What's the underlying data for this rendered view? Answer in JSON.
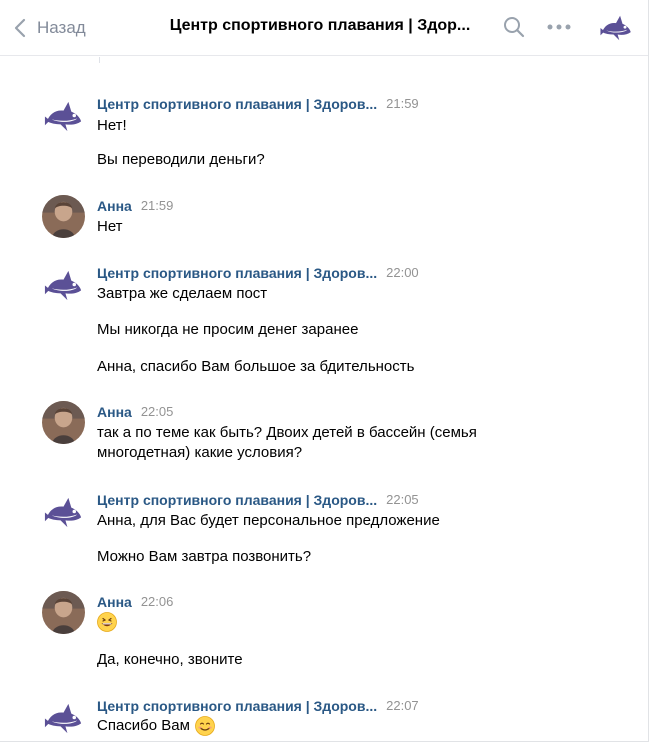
{
  "header": {
    "back_label": "Назад",
    "title": "Центр спортивного плавания | Здор...",
    "icons": [
      "back-chevron-icon",
      "search-icon",
      "more-icon",
      "shark-avatar-icon"
    ]
  },
  "colors": {
    "link": "#2a5885",
    "muted": "#828a99",
    "time": "#939393",
    "shark": "#5b5096"
  },
  "messages": [
    {
      "author": "Центр спортивного плавания | Здоров...",
      "sender": "club",
      "time": "21:59",
      "lines": [
        "Нет!",
        "Вы переводили деньги?"
      ]
    },
    {
      "author": "Анна",
      "sender": "user",
      "time": "21:59",
      "lines": [
        "Нет"
      ]
    },
    {
      "author": "Центр спортивного плавания | Здоров...",
      "sender": "club",
      "time": "22:00",
      "lines": [
        "Завтра же сделаем пост",
        "Мы никогда не просим денег заранее",
        "Анна, спасибо Вам большое за бдительность"
      ]
    },
    {
      "author": "Анна",
      "sender": "user",
      "time": "22:05",
      "lines": [
        "так а по теме как быть? Двоих детей в бассейн (семья многодетная) какие условия?"
      ]
    },
    {
      "author": "Центр спортивного плавания | Здоров...",
      "sender": "club",
      "time": "22:05",
      "lines": [
        "Анна, для Вас будет персональное предложение",
        "Можно Вам завтра позвонить?"
      ]
    },
    {
      "author": "Анна",
      "sender": "user",
      "time": "22:06",
      "lines": [
        "",
        "Да, конечно, звоните"
      ]
    },
    {
      "author": "Центр спортивного плавания | Здоров...",
      "sender": "club",
      "time": "22:07",
      "lines": [
        "Спасибо Вам"
      ]
    }
  ]
}
